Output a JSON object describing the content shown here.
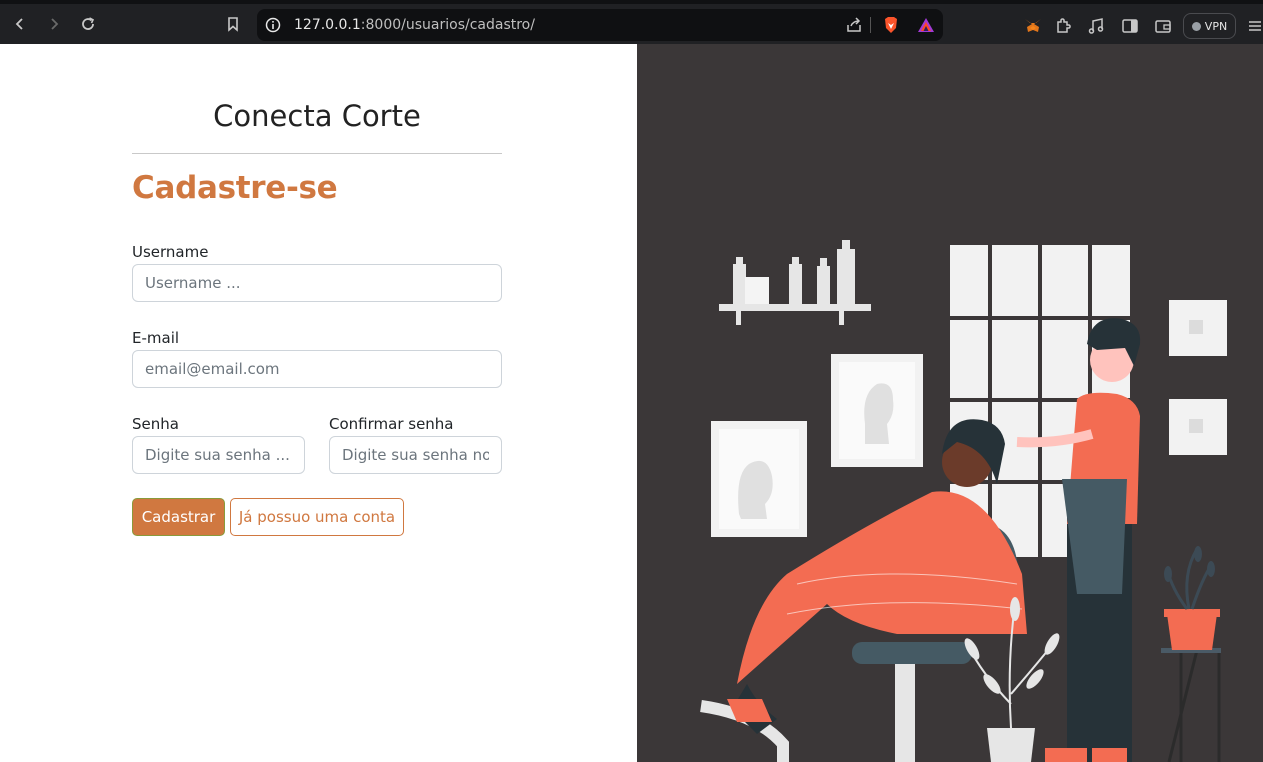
{
  "browser": {
    "url_host": "127.0.0.1",
    "url_path": ":8000/usuarios/cadastro/",
    "vpn_label": "VPN",
    "icons": [
      "back-icon",
      "forward-icon",
      "reload-icon",
      "bookmark-icon",
      "site-info-icon",
      "share-icon",
      "brave-shields-icon",
      "brave-rewards-icon",
      "metamask-icon",
      "extensions-icon",
      "media-icon",
      "sidebar-icon",
      "wallet-icon",
      "menu-icon"
    ]
  },
  "form": {
    "brand": "Conecta Corte",
    "title": "Cadastre-se",
    "username_label": "Username",
    "username_placeholder": "Username ...",
    "email_label": "E-mail",
    "email_placeholder": "email@email.com",
    "password_label": "Senha",
    "password_placeholder": "Digite sua senha ...",
    "confirm_label": "Confirmar senha",
    "confirm_placeholder": "Digite sua senha novamente ...",
    "submit_label": "Cadastrar",
    "login_label": "Já possuo uma conta"
  },
  "colors": {
    "accent": "#d07840",
    "illustration_bg": "#3b3738",
    "cape": "#f36c52"
  }
}
